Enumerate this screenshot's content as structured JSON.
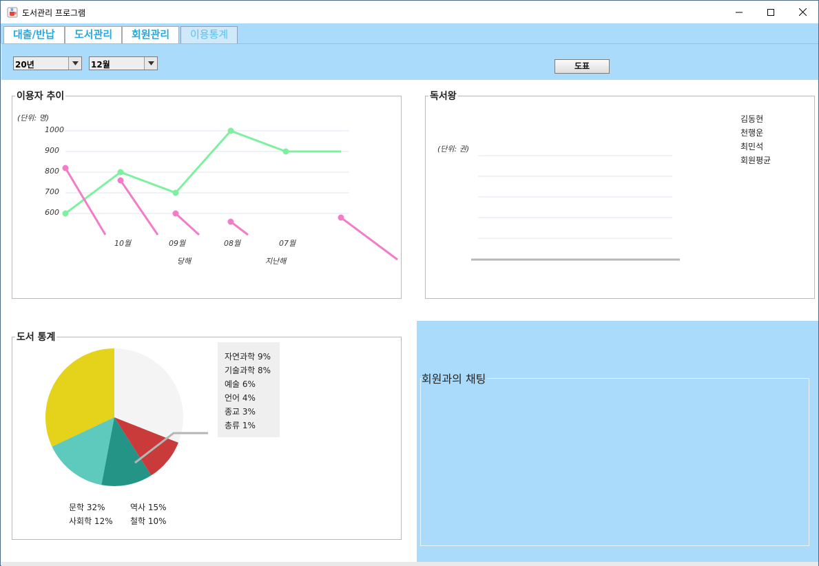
{
  "window": {
    "title": "도서관리 프로그램",
    "icons": {
      "app": "java-cup-icon",
      "minimize": "minimize-icon",
      "maximize": "maximize-icon",
      "close": "close-icon"
    }
  },
  "tabs": [
    {
      "label": "대출/반납",
      "active": false
    },
    {
      "label": "도서관리",
      "active": false
    },
    {
      "label": "회원관리",
      "active": false
    },
    {
      "label": "이용통계",
      "active": true
    }
  ],
  "controls": {
    "year_select": "20년",
    "month_select": "12월",
    "chart_button": "도표"
  },
  "usage_trend": {
    "title": "이용자 추이",
    "unit": "(단위: 명)",
    "y_ticks": [
      "1000",
      "900",
      "800",
      "700",
      "600"
    ],
    "x_ticks": [
      "10월",
      "09월",
      "08월",
      "07월"
    ],
    "legend_labels": [
      "당해",
      "지난해"
    ]
  },
  "reading_king": {
    "title": "독서왕",
    "unit": "(단위: 권)",
    "members": [
      "김동현",
      "천행운",
      "최민석",
      "회원평균"
    ]
  },
  "book_stats": {
    "title": "도서 통계",
    "callout": [
      "자연과학 9%",
      "기술과학 8%",
      "예술 6%",
      "언어 4%",
      "종교 3%",
      "총류 1%"
    ],
    "labels": [
      "문학  32%",
      "역사  15%",
      "사회학  12%",
      "철학  10%"
    ]
  },
  "chat": {
    "title": "회원과의 채팅"
  },
  "colors": {
    "accent_blue": "#aadbfa",
    "tab_text": "#2aa9e0",
    "line_current": "#7ef0a0",
    "line_last": "#f27cc8",
    "pie_literature": "#e5d21a",
    "pie_history": "#5ecabd",
    "pie_sociology": "#249486",
    "pie_philosophy": "#c93a3a",
    "pie_other": "#f4f4f4"
  },
  "chart_data": [
    {
      "type": "line",
      "title": "이용자 추이",
      "ylabel": "(단위: 명)",
      "ylim": [
        500,
        1000
      ],
      "series": [
        {
          "name": "당해",
          "x": [
            "",
            "10월",
            "09월",
            "08월",
            "07월",
            ""
          ],
          "values": [
            600,
            800,
            700,
            1000,
            900,
            900
          ]
        },
        {
          "name": "지난해",
          "x": [
            "",
            "10월",
            "09월",
            "08월",
            "07월",
            ""
          ],
          "values": [
            820,
            760,
            600,
            560,
            null,
            580
          ]
        }
      ]
    },
    {
      "type": "pie",
      "title": "도서 통계",
      "categories": [
        "문학",
        "역사",
        "사회학",
        "철학",
        "자연과학",
        "기술과학",
        "예술",
        "언어",
        "종교",
        "총류"
      ],
      "values": [
        32,
        15,
        12,
        10,
        9,
        8,
        6,
        4,
        3,
        1
      ]
    }
  ]
}
